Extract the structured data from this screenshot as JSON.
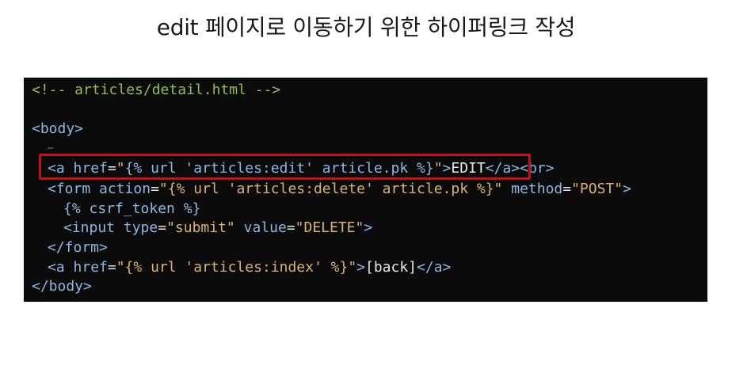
{
  "title": "edit 페이지로 이동하기 위한 하이퍼링크 작성",
  "code": {
    "comment": "<!-- articles/detail.html -->",
    "body_open": "<body>",
    "ellipsis": "…",
    "edit_link": {
      "open": "<a ",
      "attr": "href",
      "eq": "=",
      "q1": "\"",
      "tmpl": "{% url 'articles:edit' article.pk %}",
      "q2": "\"",
      "gt": ">",
      "text": "EDIT",
      "close": "</a>",
      "br": "<br>"
    },
    "form_open": {
      "open": "<form ",
      "attr1": "action",
      "val1": "\"{% url 'articles:delete' article.pk %}\"",
      "attr2": " method",
      "val2": "\"POST\"",
      "gt": ">"
    },
    "csrf": "{% csrf_token %}",
    "input": {
      "open": "<input ",
      "attr1": "type",
      "val1": "\"submit\"",
      "attr2": " value",
      "val2": "\"DELETE\"",
      "gt": ">"
    },
    "form_close": "</form>",
    "back_link": {
      "open": "<a ",
      "attr": "href",
      "val": "\"{% url 'articles:index' %}\"",
      "gt": ">",
      "text": "[back]",
      "close": "</a>"
    },
    "body_close": "</body>"
  },
  "colors": {
    "background": "#0b0b0b",
    "highlight_border": "#c0121b"
  }
}
